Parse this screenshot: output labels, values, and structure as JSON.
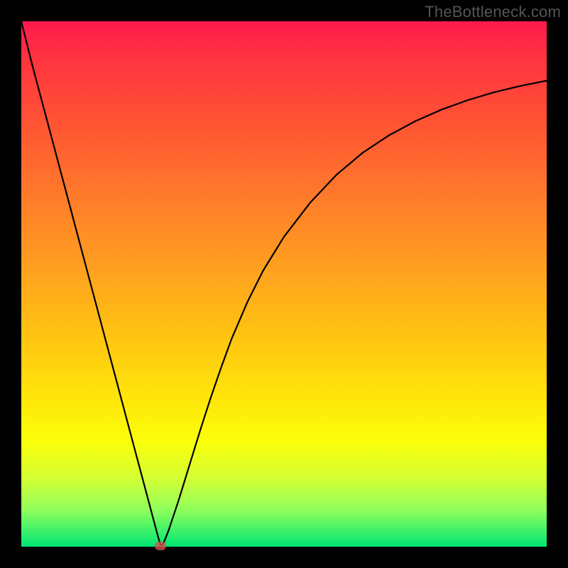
{
  "watermark": "TheBottleneck.com",
  "chart_data": {
    "type": "line",
    "title": "",
    "xlabel": "",
    "ylabel": "",
    "xlim": [
      0,
      100
    ],
    "ylim": [
      0,
      100
    ],
    "series": [
      {
        "name": "bottleneck-curve",
        "x": [
          0,
          2,
          4,
          6,
          8,
          10,
          12,
          14,
          16,
          18,
          20,
          22,
          24,
          26,
          26.5,
          27,
          28,
          30,
          32,
          34,
          36,
          38,
          40,
          43,
          46,
          50,
          55,
          60,
          65,
          70,
          75,
          80,
          85,
          90,
          95,
          100
        ],
        "values": [
          100,
          92,
          84.5,
          77,
          69.5,
          62,
          54.5,
          47,
          39.5,
          32,
          24.5,
          17,
          9.5,
          2,
          0.3,
          0.5,
          3,
          9,
          15.5,
          22,
          28.2,
          34,
          39.5,
          46.5,
          52.5,
          59,
          65.5,
          70.8,
          75,
          78.3,
          81,
          83.2,
          85,
          86.5,
          87.7,
          88.7
        ]
      }
    ],
    "marker": {
      "x": 26.5,
      "y": 0.2
    },
    "background_gradient_meaning": "vertical: red (top, high bottleneck) to green (bottom, low bottleneck)"
  }
}
